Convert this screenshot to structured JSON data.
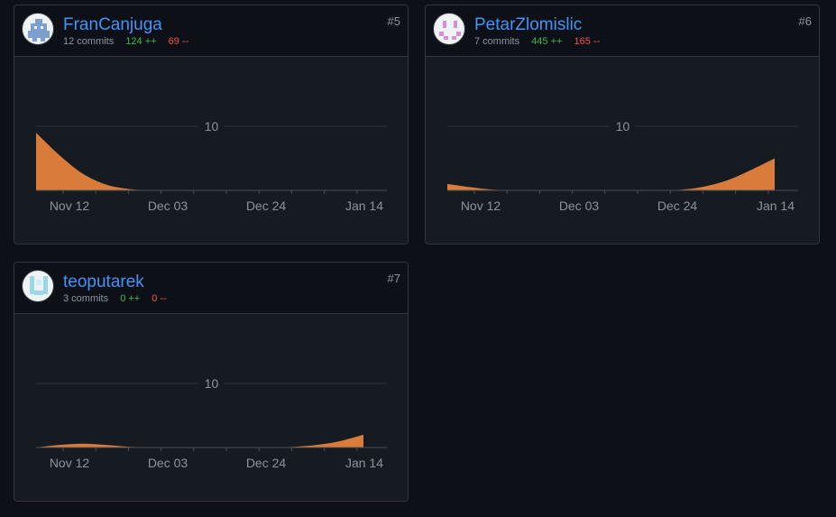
{
  "axis": {
    "x_ticks": [
      "Nov 12",
      "Dec 03",
      "Dec 24",
      "Jan 14"
    ],
    "y_tick": "10"
  },
  "colors": {
    "area": "#d97b3b",
    "grid": "#30363d",
    "link": "#4493f8"
  },
  "contributors": [
    {
      "username": "FranCanjuga",
      "commits": "12 commits",
      "additions": "124 ++",
      "deletions": "69 --",
      "rank": "#5",
      "avatar_icon": "identicon-blue"
    },
    {
      "username": "PetarZlomislic",
      "commits": "7 commits",
      "additions": "445 ++",
      "deletions": "165 --",
      "rank": "#6",
      "avatar_icon": "identicon-pink"
    },
    {
      "username": "teoputarek",
      "commits": "3 commits",
      "additions": "0 ++",
      "deletions": "0 --",
      "rank": "#7",
      "avatar_icon": "identicon-cyan"
    }
  ],
  "chart_data": [
    {
      "type": "area",
      "series": [
        {
          "values": [
            9,
            5.5,
            2.6,
            0.9,
            0.2,
            0,
            0,
            0,
            0,
            0,
            0,
            0,
            0,
            0,
            0
          ]
        }
      ],
      "x_ticks": [
        "Nov 12",
        "Dec 03",
        "Dec 24",
        "Jan 14"
      ],
      "y_ticks": [
        "10"
      ],
      "ylim": [
        0,
        10
      ],
      "grid": true
    },
    {
      "type": "area",
      "series": [
        {
          "values": [
            1,
            0.5,
            0.1,
            0,
            0,
            0,
            0,
            0,
            0,
            0,
            0.1,
            0.6,
            1.6,
            3.2,
            5
          ]
        }
      ],
      "x_ticks": [
        "Nov 12",
        "Dec 03",
        "Dec 24",
        "Jan 14"
      ],
      "y_ticks": [
        "10"
      ],
      "ylim": [
        0,
        10
      ],
      "grid": true
    },
    {
      "type": "area",
      "series": [
        {
          "values": [
            0,
            0.4,
            0.6,
            0.4,
            0.1,
            0,
            0,
            0,
            0,
            0,
            0,
            0.1,
            0.4,
            1,
            2
          ]
        }
      ],
      "x_ticks": [
        "Nov 12",
        "Dec 03",
        "Dec 24",
        "Jan 14"
      ],
      "y_ticks": [
        "10"
      ],
      "ylim": [
        0,
        10
      ],
      "grid": true
    }
  ]
}
